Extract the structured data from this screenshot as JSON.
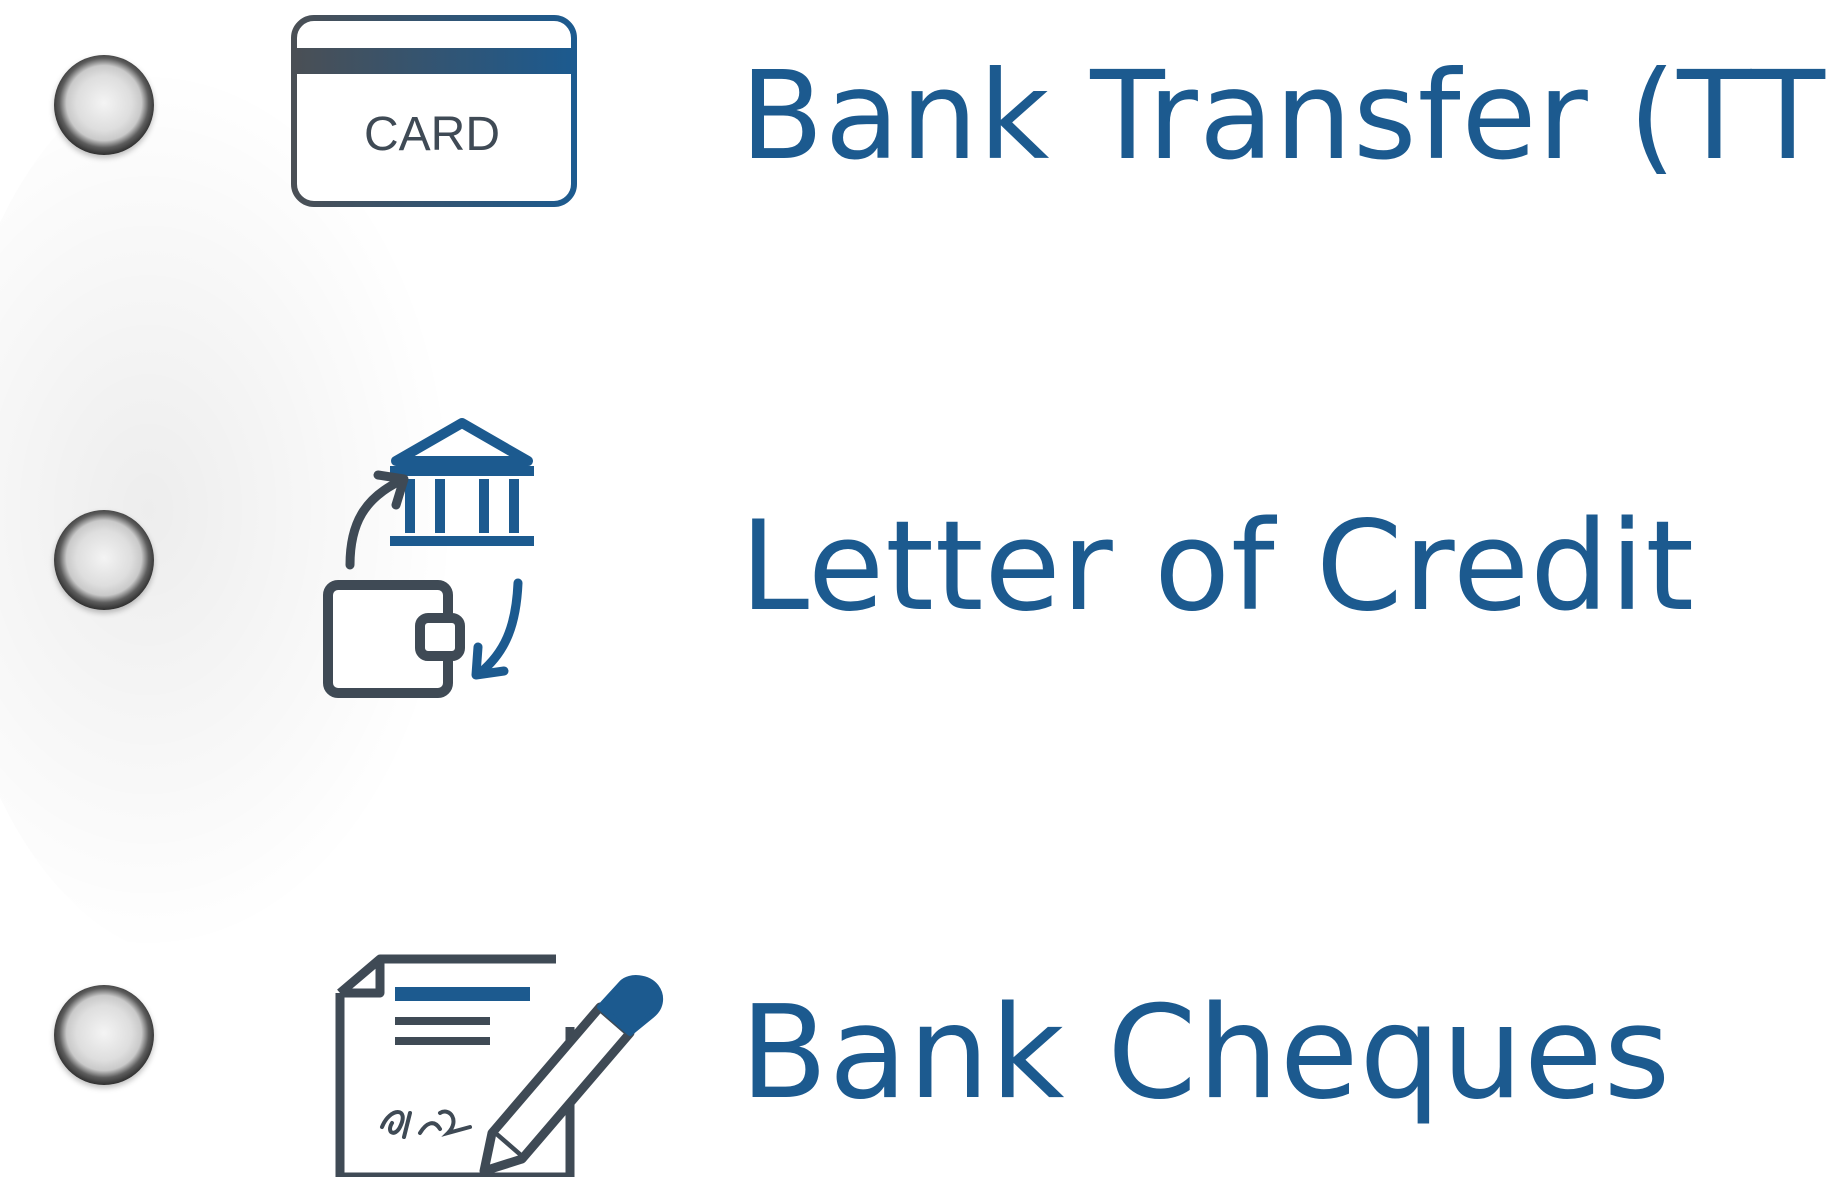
{
  "options": [
    {
      "label": "Bank Transfer (TT)",
      "icon": "credit-card-icon",
      "icon_text": "CARD",
      "selected": false
    },
    {
      "label": "Letter of Credit",
      "icon": "bank-wallet-exchange-icon",
      "selected": false
    },
    {
      "label": "Bank Cheques",
      "icon": "signed-cheque-icon",
      "selected": false
    }
  ],
  "colors": {
    "accent": "#1c5a8f",
    "icon_dark": "#3f4a55",
    "radio": "#c9c9c9"
  }
}
